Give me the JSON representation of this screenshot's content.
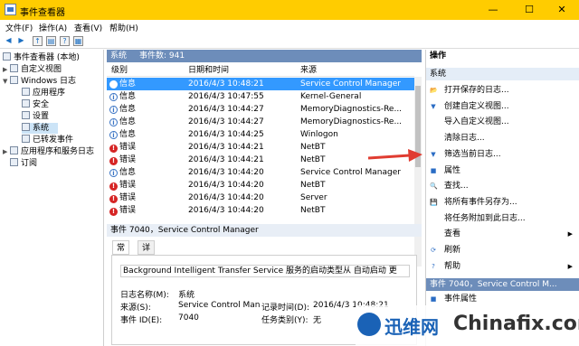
{
  "window": {
    "title": "事件查看器",
    "minimize": "—",
    "maximize": "☐",
    "close": "✕"
  },
  "menu": [
    "文件(F)",
    "操作(A)",
    "查看(V)",
    "帮助(H)"
  ],
  "toolbar": {
    "back": "◀",
    "forward": "▶",
    "up": "↑",
    "props": "▤",
    "help": "?",
    "view": "▦"
  },
  "tree": {
    "root": "事件查看器 (本地)",
    "custom_views": "自定义视图",
    "windows_logs": "Windows 日志",
    "app": "应用程序",
    "security": "安全",
    "setup": "设置",
    "system": "系统",
    "forwarded": "已转发事件",
    "app_services": "应用程序和服务日志",
    "subscriptions": "订阅"
  },
  "center": {
    "header_name": "系统",
    "header_count": "事件数: 941",
    "columns": {
      "level": "级别",
      "datetime": "日期和时间",
      "source": "来源"
    },
    "rows": [
      {
        "level": "信息",
        "type": "info",
        "datetime": "2016/4/3 10:48:21",
        "source": "Service Control Manager"
      },
      {
        "level": "信息",
        "type": "info",
        "datetime": "2016/4/3 10:47:55",
        "source": "Kernel-General"
      },
      {
        "level": "信息",
        "type": "info",
        "datetime": "2016/4/3 10:44:27",
        "source": "MemoryDiagnostics-Re..."
      },
      {
        "level": "信息",
        "type": "info",
        "datetime": "2016/4/3 10:44:27",
        "source": "MemoryDiagnostics-Re..."
      },
      {
        "level": "信息",
        "type": "info",
        "datetime": "2016/4/3 10:44:25",
        "source": "Winlogon"
      },
      {
        "level": "错误",
        "type": "error",
        "datetime": "2016/4/3 10:44:21",
        "source": "NetBT"
      },
      {
        "level": "错误",
        "type": "error",
        "datetime": "2016/4/3 10:44:21",
        "source": "NetBT"
      },
      {
        "level": "信息",
        "type": "info",
        "datetime": "2016/4/3 10:44:20",
        "source": "Service Control Manager"
      },
      {
        "level": "错误",
        "type": "error",
        "datetime": "2016/4/3 10:44:20",
        "source": "NetBT"
      },
      {
        "level": "错误",
        "type": "error",
        "datetime": "2016/4/3 10:44:20",
        "source": "Server"
      },
      {
        "level": "错误",
        "type": "error",
        "datetime": "2016/4/3 10:44:20",
        "source": "NetBT"
      }
    ],
    "detail_header": "事件 7040，Service Control Manager",
    "tabs": [
      "常规",
      "详细信息"
    ],
    "description": "Background Intelligent Transfer Service 服务的启动类型从 自动启动 更",
    "fields": {
      "log_name_label": "日志名称(M):",
      "log_name": "系统",
      "source_label": "来源(S):",
      "source": "Service Control Man",
      "logged_label": "记录时间(D):",
      "logged": "2016/4/3 10:48:21",
      "event_id_label": "事件 ID(E):",
      "event_id": "7040",
      "task_label": "任务类别(Y):",
      "task": "无"
    }
  },
  "actions": {
    "title": "操作",
    "group1": "系统",
    "items1": [
      {
        "icon": "folder-open-icon",
        "label": "打开保存的日志..."
      },
      {
        "icon": "filter-icon",
        "label": "创建自定义视图..."
      },
      {
        "icon": "",
        "label": "导入自定义视图..."
      },
      {
        "icon": "",
        "label": "清除日志..."
      },
      {
        "icon": "filter-icon",
        "label": "筛选当前日志..."
      },
      {
        "icon": "properties-icon",
        "label": "属性"
      },
      {
        "icon": "find-icon",
        "label": "查找..."
      },
      {
        "icon": "save-icon",
        "label": "将所有事件另存为..."
      },
      {
        "icon": "",
        "label": "将任务附加到此日志..."
      },
      {
        "icon": "",
        "label": "查看",
        "submenu": true
      },
      {
        "icon": "refresh-icon",
        "label": "刷新"
      },
      {
        "icon": "help-icon",
        "label": "帮助",
        "submenu": true
      }
    ],
    "group2": "事件 7040，Service Control M...",
    "items2": [
      {
        "icon": "properties-icon",
        "label": "事件属性"
      }
    ]
  },
  "watermark": {
    "cn": "迅维网",
    "en": "Chinafix.com"
  },
  "colors": {
    "titlebar": "#ffcc00",
    "selection": "#3399ff",
    "header": "#6d8dba",
    "arrow": "#e03c31"
  }
}
